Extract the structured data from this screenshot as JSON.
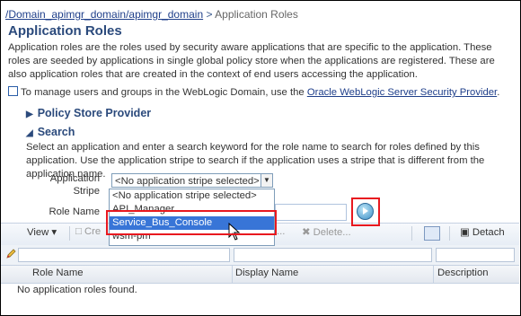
{
  "breadcrumb": {
    "link": "/Domain_apimgr_domain/apimgr_domain",
    "separator": " > ",
    "current": "Application Roles"
  },
  "page": {
    "title": "Application Roles",
    "description": "Application roles are the roles used by security aware applications that are specific to the application. These roles are seeded by applications in single global policy store when the applications are registered. These are also application roles that are created in the context of end users accessing the application.",
    "manage_text": "To manage users and groups in the WebLogic Domain, use the ",
    "manage_link": "Oracle WebLogic Server Security Provider",
    "manage_suffix": "."
  },
  "sections": {
    "policy_store": "Policy Store Provider",
    "search": "Search",
    "search_description": "Select an application and enter a search keyword for the role name to search for roles defined by this application. Use the application stripe to search if the application uses a stripe that is different from the application name."
  },
  "form": {
    "stripe_label_1": "Application",
    "stripe_label_2": "Stripe",
    "stripe_selected": "<No application stripe selected>",
    "role_name_label": "Role Name",
    "dropdown_options": [
      "<No application stripe selected>",
      "API_Manager",
      "Service_Bus_Console",
      "wsm-pm"
    ],
    "highlighted_option": "Service_Bus_Console"
  },
  "toolbar": {
    "view": "View",
    "create": "Cre",
    "delete": "Delete...",
    "ellipsis": "...",
    "detach": "Detach"
  },
  "table": {
    "columns": [
      "Role Name",
      "Display Name",
      "Description"
    ],
    "empty_message": "No application roles found."
  },
  "colors": {
    "highlight": "#e8181f",
    "selected": "#3875d7",
    "title": "#2b4a7c"
  }
}
